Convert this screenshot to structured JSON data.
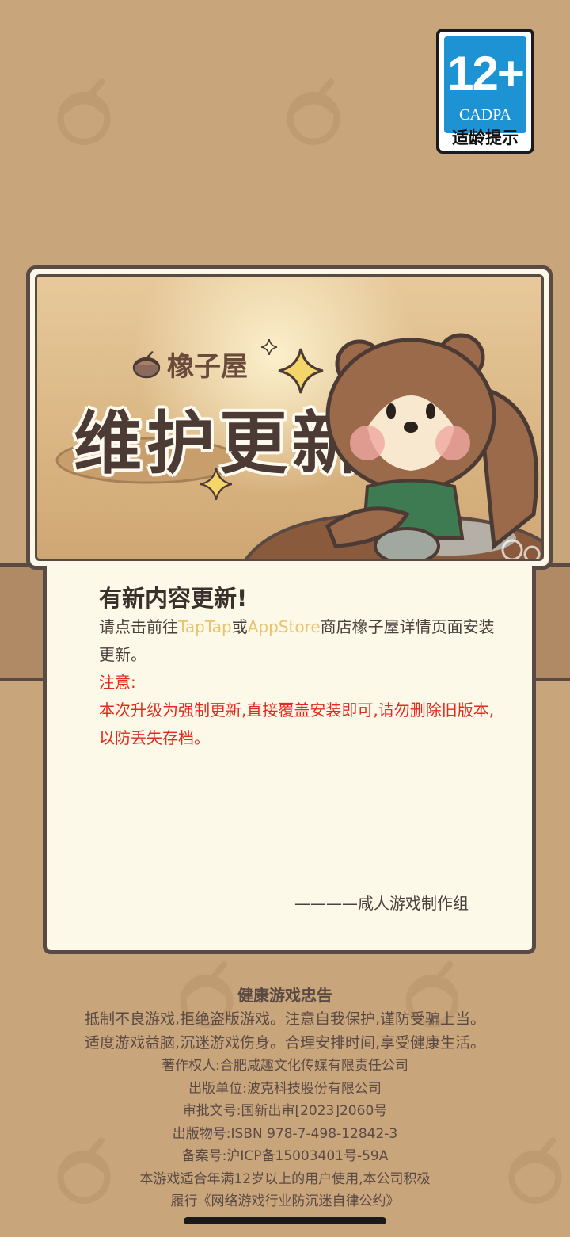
{
  "age_rating": {
    "age": "12+",
    "org": "CADPA",
    "label": "适龄提示"
  },
  "banner": {
    "game_name": "橡子屋",
    "title": "维护更新"
  },
  "notice": {
    "title": "有新内容更新!",
    "body_prefix": "请点击前往",
    "link1": "TapTap",
    "or": "或",
    "link2": "AppStore",
    "body_suffix": "商店橡子屋详情页面安装更新。",
    "warn_label": "注意:",
    "warn_text": "本次升级为强制更新,直接覆盖安装即可,请勿删除旧版本,以防丢失存档。",
    "signature": "————咸人游戏制作组"
  },
  "footer": {
    "title": "健康游戏忠告",
    "line1": "抵制不良游戏,拒绝盗版游戏。注意自我保护,谨防受骗上当。",
    "line2": "适度游戏益脑,沉迷游戏伤身。合理安排时间,享受健康生活。",
    "copyright": "著作权人:合肥咸趣文化传媒有限责任公司",
    "publisher": "出版单位:波克科技股份有限公司",
    "approval": "审批文号:国新出审[2023]2060号",
    "isbn": "出版物号:ISBN 978-7-498-12842-3",
    "icp": "备案号:沪ICP备15003401号-59A",
    "age_notice": "本游戏适合年满12岁以上的用户使用,本公司积极",
    "convention": "履行《网络游戏行业防沉迷自律公约》"
  },
  "colors": {
    "background": "#c9a57c",
    "border": "#5a4a44",
    "link": "#e8c46c",
    "warning": "#e32a1e",
    "badge_blue": "#1e93d3"
  }
}
